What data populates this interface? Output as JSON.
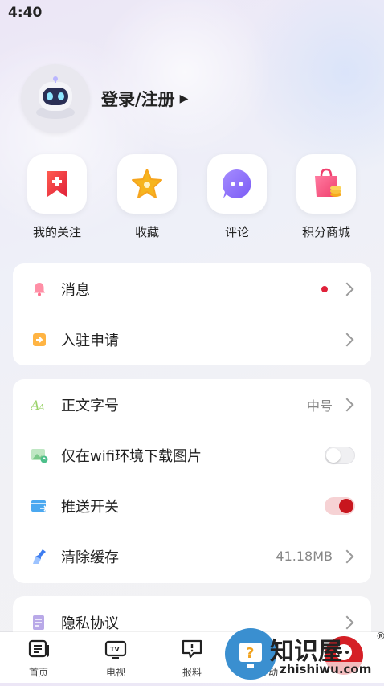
{
  "status_bar": {
    "time": "4:40"
  },
  "profile": {
    "login_text": "登录/注册"
  },
  "quick_actions": [
    {
      "label": "我的关注",
      "icon": "bookmark-plus-icon"
    },
    {
      "label": "收藏",
      "icon": "star-icon"
    },
    {
      "label": "评论",
      "icon": "chat-bubble-icon"
    },
    {
      "label": "积分商城",
      "icon": "shopping-bag-icon"
    }
  ],
  "group1": {
    "messages": {
      "label": "消息",
      "icon": "bell-icon",
      "has_badge": true
    },
    "apply": {
      "label": "入驻申请",
      "icon": "enter-icon"
    }
  },
  "group2": {
    "font_size": {
      "label": "正文字号",
      "value": "中号",
      "icon": "font-size-icon"
    },
    "wifi_images": {
      "label": "仅在wifi环境下载图片",
      "icon": "image-wifi-icon",
      "enabled": false
    },
    "push": {
      "label": "推送开关",
      "icon": "push-icon",
      "enabled": true
    },
    "cache": {
      "label": "清除缓存",
      "value": "41.18MB",
      "icon": "broom-icon"
    }
  },
  "group3": {
    "privacy": {
      "label": "隐私协议",
      "icon": "document-icon"
    }
  },
  "tabbar": {
    "tabs": [
      {
        "label": "首页",
        "icon": "news-icon"
      },
      {
        "label": "电视",
        "icon": "tv-icon"
      },
      {
        "label": "报料",
        "icon": "report-icon"
      },
      {
        "label": "互动",
        "icon": "interact-icon"
      }
    ]
  },
  "watermark": {
    "text": "知识屋",
    "domain": "zhishiwu.com"
  },
  "colors": {
    "accent": "#c8161e",
    "badge": "#e0213a"
  }
}
